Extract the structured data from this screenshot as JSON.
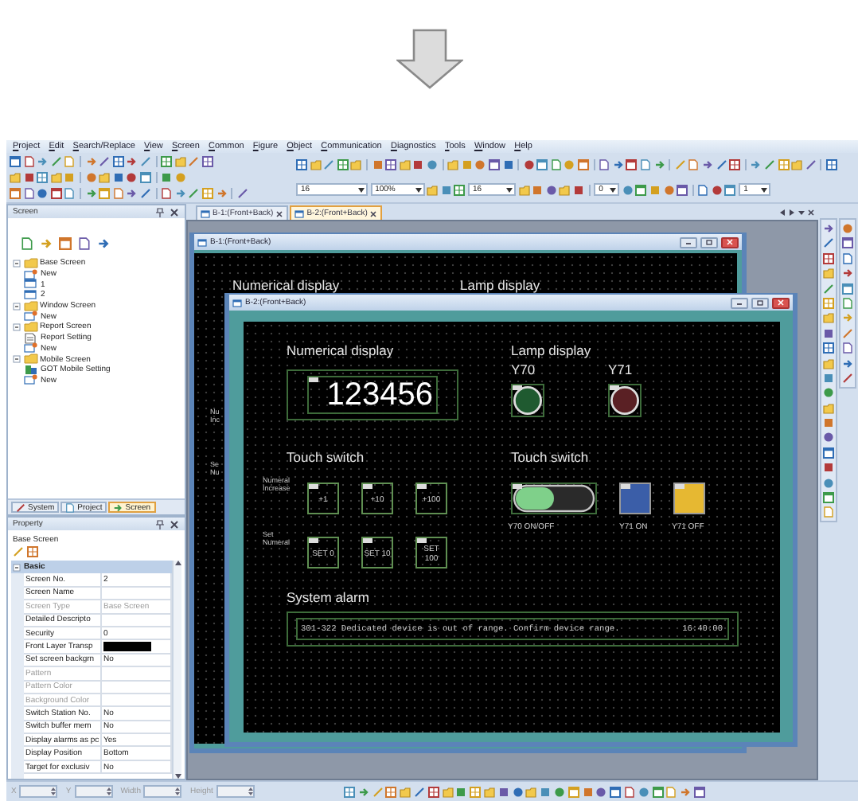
{
  "menu": [
    "Project",
    "Edit",
    "Search/Replace",
    "View",
    "Screen",
    "Common",
    "Figure",
    "Object",
    "Communication",
    "Diagnostics",
    "Tools",
    "Window",
    "Help"
  ],
  "toolbar_fields": [
    "16",
    "100%",
    "16",
    "0",
    "1"
  ],
  "screen_panel": {
    "title": "Screen",
    "tree": [
      {
        "label": "Base Screen",
        "kind": "folder",
        "expanded": true,
        "children": [
          {
            "label": "New",
            "kind": "new"
          },
          {
            "label": "1",
            "kind": "screen"
          },
          {
            "label": "2",
            "kind": "screen"
          }
        ]
      },
      {
        "label": "Window Screen",
        "kind": "folder",
        "expanded": true,
        "children": [
          {
            "label": "New",
            "kind": "new"
          }
        ]
      },
      {
        "label": "Report Screen",
        "kind": "folder",
        "expanded": true,
        "children": [
          {
            "label": "Report Setting",
            "kind": "setting"
          },
          {
            "label": "New",
            "kind": "new"
          }
        ]
      },
      {
        "label": "Mobile Screen",
        "kind": "folder",
        "expanded": true,
        "children": [
          {
            "label": "GOT Mobile Setting",
            "kind": "mobile"
          },
          {
            "label": "New",
            "kind": "new"
          }
        ]
      }
    ],
    "tabs": [
      {
        "label": "System",
        "selected": false
      },
      {
        "label": "Project",
        "selected": false
      },
      {
        "label": "Screen",
        "selected": true
      }
    ]
  },
  "property_panel": {
    "title": "Property",
    "target": "Base Screen",
    "section": {
      "label": "Basic",
      "expanded": true
    },
    "rows": [
      {
        "name": "Screen No.",
        "kind": "text",
        "value": "2",
        "disabled": false
      },
      {
        "name": "Screen Name",
        "kind": "text",
        "disabled": false
      },
      {
        "name": "Screen Type",
        "kind": "text",
        "value": "Base Screen",
        "disabled": true
      },
      {
        "name": "Detailed Descripto",
        "kind": "text",
        "disabled": false
      },
      {
        "name": "Security",
        "kind": "text",
        "value": "0",
        "disabled": false
      },
      {
        "name": "Front Layer Transp",
        "kind": "color",
        "color": "#000000",
        "disabled": false
      },
      {
        "name": "Set screen backgrn",
        "kind": "text",
        "value": "No",
        "disabled": false
      },
      {
        "name": "Pattern",
        "kind": "text",
        "disabled": true
      },
      {
        "name": "Pattern Color",
        "kind": "text",
        "disabled": true
      },
      {
        "name": "Background Color",
        "kind": "text",
        "disabled": true
      },
      {
        "name": "Switch Station No.",
        "kind": "text",
        "value": "No",
        "disabled": false
      },
      {
        "name": "Switch buffer mem",
        "kind": "text",
        "value": "No",
        "disabled": false
      },
      {
        "name": "Display alarms as pc",
        "kind": "text",
        "value": "Yes",
        "disabled": false
      },
      {
        "name": "Display Position",
        "kind": "text",
        "value": "Bottom",
        "disabled": false
      },
      {
        "name": "Target for exclusiv",
        "kind": "text",
        "value": "No",
        "disabled": false
      }
    ]
  },
  "doc_tabs": [
    {
      "label": "B-1:(Front+Back)",
      "selected": false
    },
    {
      "label": "B-2:(Front+Back)",
      "selected": true
    }
  ],
  "back_window": {
    "title": "B-1:(Front+Back)",
    "headings": [
      "Numerical display",
      "Lamp display"
    ],
    "side_labels": [
      "Nu Inc",
      "Se Nu"
    ]
  },
  "front_window": {
    "title": "B-2:(Front+Back)",
    "numerical_display": {
      "heading": "Numerical display",
      "value": "123456"
    },
    "lamp_display": {
      "heading": "Lamp display",
      "lamps": [
        {
          "label": "Y70",
          "color": "#1f5a30"
        },
        {
          "label": "Y71",
          "color": "#5a2024"
        }
      ]
    },
    "numeric_switches": {
      "heading": "Touch switch",
      "rows": [
        {
          "label": "Numeral Increase",
          "buttons": [
            "+1",
            "+10",
            "+100"
          ]
        },
        {
          "label": "Set Numeral",
          "buttons": [
            "SET 0",
            "SET 10",
            "SET 100"
          ]
        }
      ]
    },
    "bit_switches": {
      "heading": "Touch switch",
      "items": [
        {
          "kind": "toggle",
          "label": "Y70 ON/OFF",
          "on": true
        },
        {
          "kind": "square",
          "label": "Y71 ON",
          "color": "#3b5ea8"
        },
        {
          "kind": "square",
          "label": "Y71 OFF",
          "color": "#e6b832"
        }
      ]
    },
    "system_alarm": {
      "heading": "System alarm",
      "message": "301-322 Dedicated device is out of range. Confirm device range.",
      "time": "16:40:00"
    }
  },
  "position_fields": [
    {
      "label": "X",
      "disabled": true
    },
    {
      "label": "Y",
      "disabled": true
    },
    {
      "label": "Width",
      "disabled": true
    },
    {
      "label": "Height",
      "disabled": true
    }
  ]
}
